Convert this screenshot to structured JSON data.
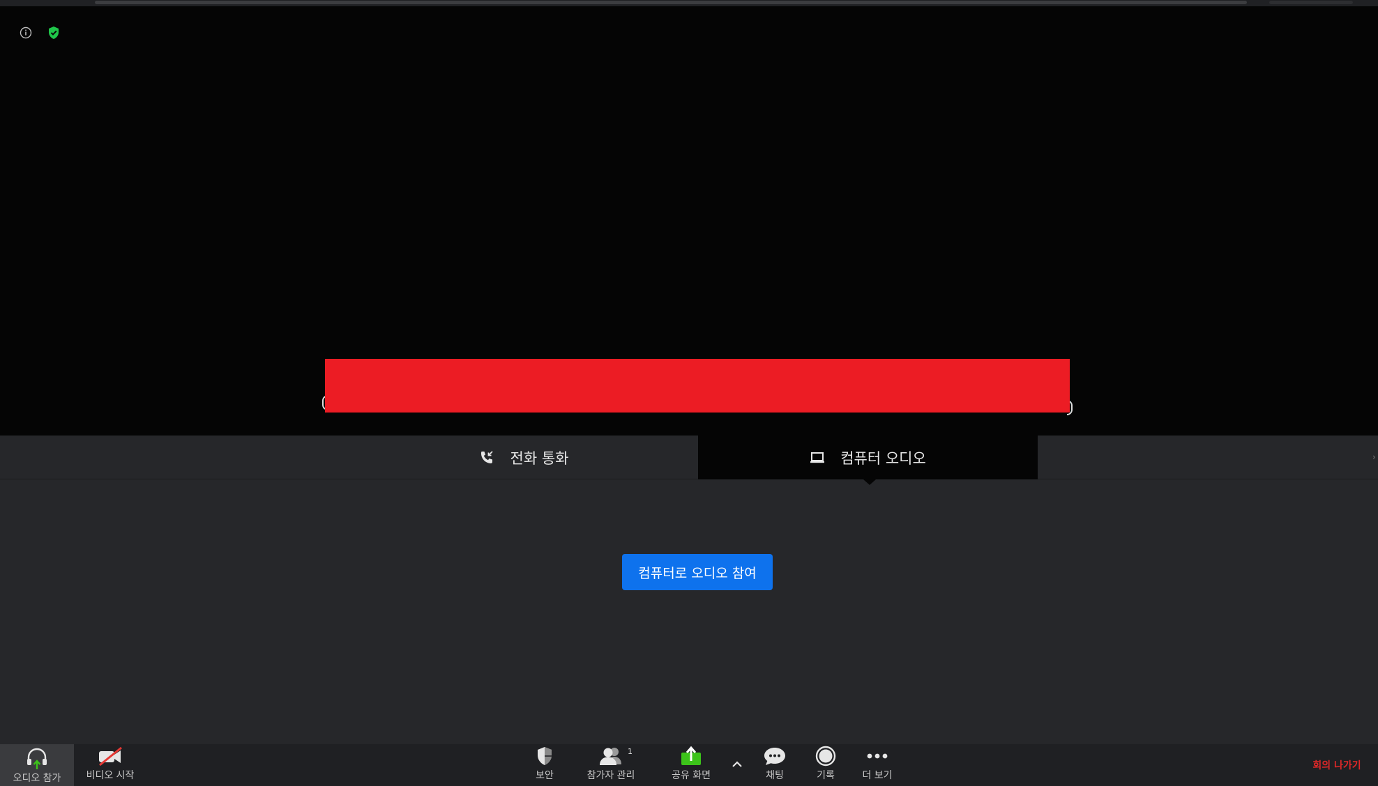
{
  "audio_tabs": {
    "phone_label": "전화 통화",
    "computer_label": "컴퓨터 오디오"
  },
  "join_button_label": "컴퓨터로 오디오 참여",
  "toolbar": {
    "audio_label": "오디오 참가",
    "video_label": "비디오 시작",
    "security_label": "보안",
    "participants_label": "참가자 관리",
    "participants_count": "1",
    "share_label": "공유 화면",
    "chat_label": "채팅",
    "record_label": "기록",
    "more_label": "더 보기",
    "leave_label": "회의 나가기"
  },
  "colors": {
    "primary_button": "#0e72ed",
    "share_icon": "#3cc31a",
    "leave_text": "#e02828",
    "encrypted_shield": "#1fc64a",
    "redaction": "#ec1c24"
  }
}
